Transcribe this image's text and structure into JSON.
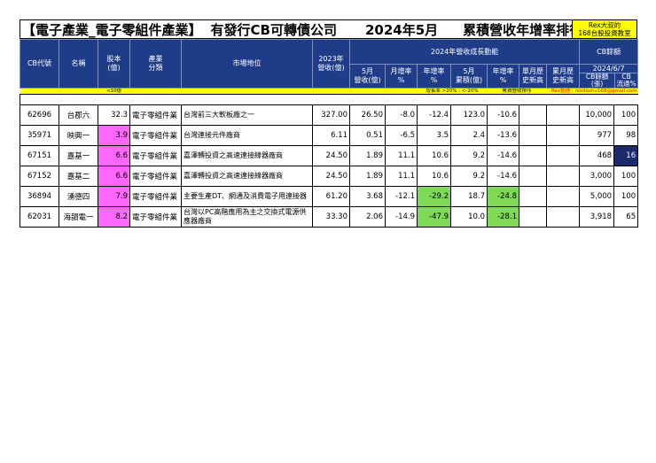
{
  "title": {
    "industry": "【電子產業_電子零組件產業】",
    "subject": "有發行CB可轉債公司",
    "period": "2024年5月",
    "ranking": "累積營收年增率排行"
  },
  "brand": {
    "line1": "Rex大叔的",
    "line2": "168台股投資教室"
  },
  "header": {
    "code": "CB代號",
    "name": "名稱",
    "capital": "股本\n(億)",
    "industry": "產業\n分類",
    "position": "市場地位",
    "revenue2023": "2023年\n營收(億)",
    "group_label": "2024年營收成長動能",
    "may_rev": "5月\n營收(億)",
    "mom": "月增率\n%",
    "yoy": "年增率\n%",
    "cum_rev": "5月\n累積(億)",
    "cum_yoy": "年增率\n%",
    "month_high": "單月歷\n史新高",
    "cum_high": "累月歷\n史新高",
    "cb_group": "CB餘額",
    "cb_date": "2024/6/7",
    "cb_balance": "CB餘額\n(張)",
    "cb_float": "CB\n流通%"
  },
  "notes": {
    "capital": "<10億",
    "yoy": "增長率 >20% ; <-20%",
    "cum": "累積營收排序",
    "contact": "Rex整理 : rexdashu168@gmail.com"
  },
  "colors": {
    "header_bg": "#1f3c88",
    "highlight_pink": "#ff66ff",
    "highlight_green": "#7ed957",
    "highlight_navy": "#1a2a6c",
    "note_yellow": "#ffff00"
  },
  "rows": [
    {
      "code": "62696",
      "name": "台郡六",
      "capital": "32.3",
      "industry": "電子零組件業",
      "position": "台灣前三大軟板廠之一",
      "rev2023": "327.00",
      "may_rev": "26.50",
      "mom": "-8.0",
      "yoy": "-12.4",
      "cum_rev": "123.0",
      "cum_yoy": "-10.6",
      "month_high": "",
      "cum_high": "",
      "cb_balance": "10,000",
      "cb_float": "100",
      "hl_capital": false,
      "hl_yoy": false,
      "hl_cum": false,
      "hl_float": false
    },
    {
      "code": "35971",
      "name": "映興一",
      "capital": "3.9",
      "industry": "電子零組件業",
      "position": "台灣連接元件廠商",
      "rev2023": "6.11",
      "may_rev": "0.51",
      "mom": "-6.5",
      "yoy": "3.5",
      "cum_rev": "2.4",
      "cum_yoy": "-13.6",
      "month_high": "",
      "cum_high": "",
      "cb_balance": "977",
      "cb_float": "98",
      "hl_capital": true,
      "hl_yoy": false,
      "hl_cum": false,
      "hl_float": false
    },
    {
      "code": "67151",
      "name": "嘉基一",
      "capital": "6.6",
      "industry": "電子零組件業",
      "position": "嘉澤轉投資之高速連接線器廠商",
      "rev2023": "24.50",
      "may_rev": "1.89",
      "mom": "11.1",
      "yoy": "10.6",
      "cum_rev": "9.2",
      "cum_yoy": "-14.6",
      "month_high": "",
      "cum_high": "",
      "cb_balance": "468",
      "cb_float": "16",
      "hl_capital": true,
      "hl_yoy": false,
      "hl_cum": false,
      "hl_float": true
    },
    {
      "code": "67152",
      "name": "嘉基二",
      "capital": "6.6",
      "industry": "電子零組件業",
      "position": "嘉澤轉投資之高速連接線器廠商",
      "rev2023": "24.50",
      "may_rev": "1.89",
      "mom": "11.1",
      "yoy": "10.6",
      "cum_rev": "9.2",
      "cum_yoy": "-14.6",
      "month_high": "",
      "cum_high": "",
      "cb_balance": "3,000",
      "cb_float": "100",
      "hl_capital": true,
      "hl_yoy": false,
      "hl_cum": false,
      "hl_float": false
    },
    {
      "code": "36894",
      "name": "湧德四",
      "capital": "7.9",
      "industry": "電子零組件業",
      "position": "主要生產DT、網通及消費電子用連接器",
      "rev2023": "61.20",
      "may_rev": "3.68",
      "mom": "-12.1",
      "yoy": "-29.2",
      "cum_rev": "18.7",
      "cum_yoy": "-24.8",
      "month_high": "",
      "cum_high": "",
      "cb_balance": "5,000",
      "cb_float": "100",
      "hl_capital": true,
      "hl_yoy": true,
      "hl_cum": true,
      "hl_float": false
    },
    {
      "code": "62031",
      "name": "海韻電一",
      "capital": "8.2",
      "industry": "電子零組件業",
      "position": "台灣以PC高階應用為主之交換式電源供應器廠商",
      "rev2023": "33.30",
      "may_rev": "2.06",
      "mom": "-14.9",
      "yoy": "-47.9",
      "cum_rev": "10.0",
      "cum_yoy": "-28.1",
      "month_high": "",
      "cum_high": "",
      "cb_balance": "3,918",
      "cb_float": "65",
      "hl_capital": true,
      "hl_yoy": true,
      "hl_cum": true,
      "hl_float": false
    }
  ]
}
